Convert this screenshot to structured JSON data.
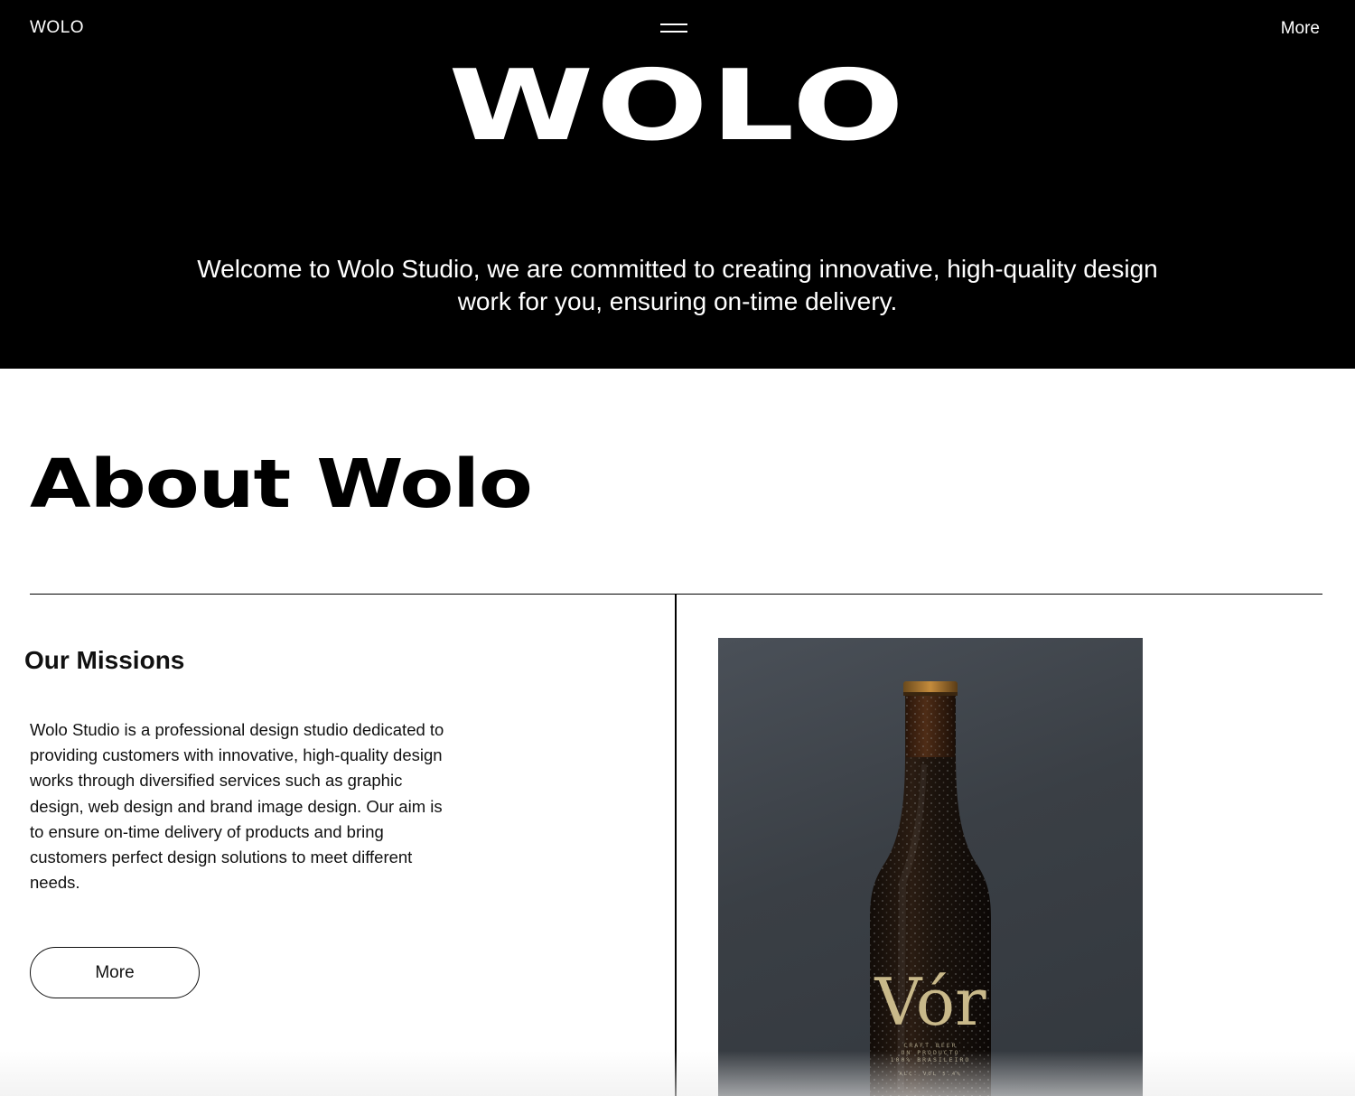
{
  "header": {
    "logo_text": "WOLO",
    "menu_icon": "hamburger-icon",
    "more_label": "More"
  },
  "hero": {
    "brand_title": "WOLO",
    "tagline_line1": "Welcome to Wolo Studio, we are committed to creating innovative, high-quality design",
    "tagline_line2": "work for you, ensuring on-time delivery."
  },
  "about": {
    "title": "About Wolo",
    "missions_heading": "Our Missions",
    "missions_text": "Wolo Studio is a professional design studio dedicated to providing customers with innovative, high-quality design works through diversified services such as graphic design, web design and brand image design. Our aim is to ensure on-time delivery of products and bring customers perfect design solutions to meet different needs.",
    "more_button": "More"
  },
  "product_image": {
    "label_brand": "Vór",
    "label_line1": "CRAFT BEER",
    "label_line2": "UN PRODUCTO",
    "label_line3": "100% BRASILEIRO",
    "label_line4": "ALC. VOL 5.4%"
  },
  "colors": {
    "hero_background": "#000000",
    "page_background": "#ffffff",
    "text_primary": "#111111",
    "photo_background": "#3a3f45",
    "label_gold": "#c9b98a"
  }
}
